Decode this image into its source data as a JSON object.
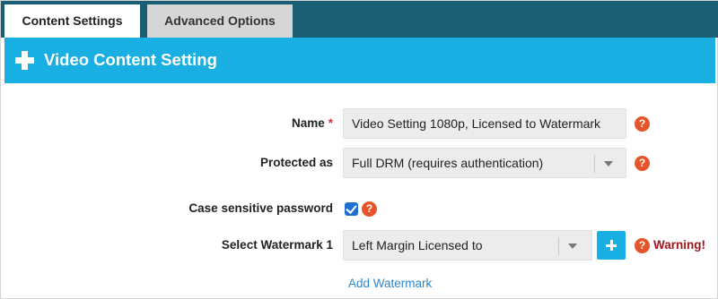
{
  "tabs": [
    {
      "label": "Content Settings",
      "active": true
    },
    {
      "label": "Advanced Options",
      "active": false
    }
  ],
  "section": {
    "title": "Video Content Setting",
    "icon": "plus-icon"
  },
  "form": {
    "name": {
      "label": "Name",
      "required_mark": "*",
      "value": "Video Setting 1080p, Licensed to Watermark"
    },
    "protected_as": {
      "label": "Protected as",
      "value": "Full DRM (requires authentication)"
    },
    "case_sensitive_password": {
      "label": "Case sensitive password",
      "checked": true
    },
    "watermark": {
      "label": "Select Watermark 1",
      "value": "Left Margin Licensed to",
      "warning": "Warning!"
    },
    "add_watermark": "Add Watermark",
    "help_glyph": "?"
  },
  "colors": {
    "tabbar": "#1b5f74",
    "header": "#19afe2",
    "help": "#e8542a",
    "warning": "#a3151c",
    "link": "#2e86c9",
    "checkbox": "#1f6fd1"
  }
}
